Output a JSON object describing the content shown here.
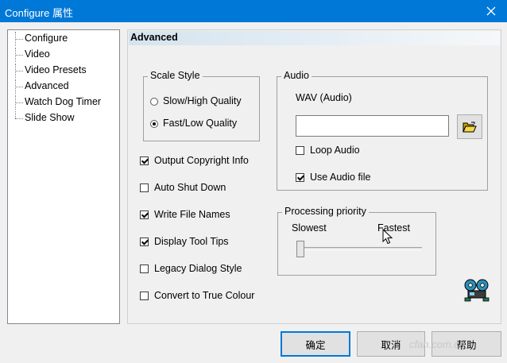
{
  "window": {
    "title": "Configure 属性",
    "close_symbol": "✕"
  },
  "tree": {
    "items": [
      {
        "label": "Configure"
      },
      {
        "label": "Video"
      },
      {
        "label": "Video Presets"
      },
      {
        "label": "Advanced",
        "selected": true
      },
      {
        "label": "Watch Dog Timer"
      },
      {
        "label": "Slide Show"
      }
    ]
  },
  "panel": {
    "header": "Advanced",
    "scale_style": {
      "legend": "Scale Style",
      "options": [
        {
          "label": "Slow/High Quality",
          "selected": false
        },
        {
          "label": "Fast/Low Quality",
          "selected": true
        }
      ]
    },
    "options": [
      {
        "label": "Output Copyright Info",
        "checked": true
      },
      {
        "label": "Auto Shut Down",
        "checked": false
      },
      {
        "label": "Write File Names",
        "checked": true
      },
      {
        "label": "Display Tool Tips",
        "checked": true
      },
      {
        "label": "Legacy Dialog Style",
        "checked": false
      },
      {
        "label": "Convert to True Colour",
        "checked": false
      }
    ],
    "audio": {
      "legend": "Audio",
      "wav_label": "WAV (Audio)",
      "wav_value": "",
      "browse_icon": "folder-open-icon",
      "loop_label": "Loop Audio",
      "loop_checked": false,
      "use_file_label": "Use Audio file",
      "use_file_checked": true
    },
    "priority": {
      "legend": "Processing priority",
      "min_label": "Slowest",
      "max_label": "Fastest",
      "value": 0
    }
  },
  "buttons": {
    "ok": "确定",
    "cancel": "取消",
    "help": "帮助"
  },
  "watermark": "cfan.com.cn",
  "colors": {
    "titlebar": "#0078d7",
    "default_button_border": "#0078d7"
  }
}
